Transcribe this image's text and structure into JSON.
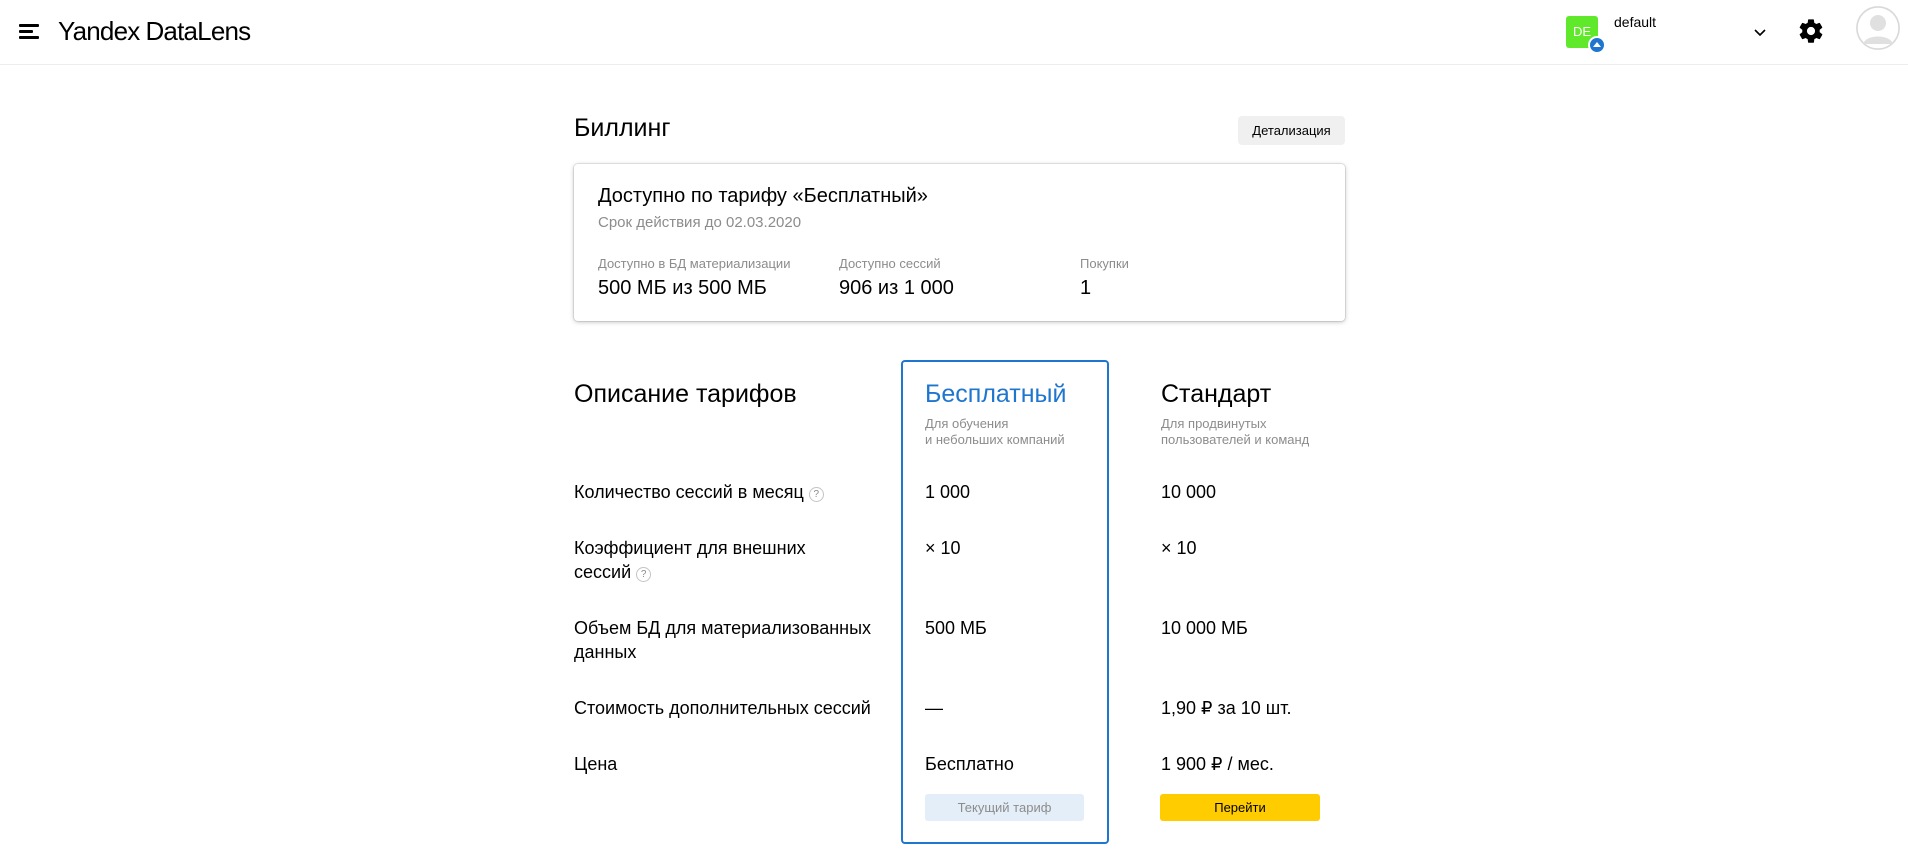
{
  "header": {
    "logo_brand": "Yandex",
    "logo_product": "DataLens",
    "project": {
      "avatar_text": "DE",
      "avatar_color": "#5fe92a",
      "name": "default"
    },
    "icons": [
      "menu-icon",
      "chevron-down-icon",
      "gear-icon",
      "user-icon"
    ]
  },
  "billing": {
    "title": "Биллинг",
    "details_button": "Детализация",
    "summary": {
      "title": "Доступно по тарифу «Бесплатный»",
      "validity": "Срок действия до 02.03.2020",
      "stats": [
        {
          "label": "Доступно в БД материализации",
          "value": "500 МБ из 500 МБ"
        },
        {
          "label": "Доступно сессий",
          "value": "906 из 1 000"
        },
        {
          "label": "Покупки",
          "value": "1"
        }
      ]
    }
  },
  "tariffs": {
    "title": "Описание тарифов",
    "accent_color": "#1f76ce",
    "plans": [
      {
        "name": "Бесплатный",
        "desc_line1": "Для обучения",
        "desc_line2": "и небольших компаний",
        "button": "Текущий тариф"
      },
      {
        "name": "Стандарт",
        "desc_line1": "Для продвинутых",
        "desc_line2": "пользователей и команд",
        "button": "Перейти"
      }
    ],
    "rows": [
      {
        "label": "Количество сессий в месяц",
        "help": "?",
        "free": "1 000",
        "standard": "10 000"
      },
      {
        "label": "Коэффициент для внешних сессий",
        "help": "?",
        "free": "× 10",
        "standard": "× 10"
      },
      {
        "label": "Объем БД для материализованных данных",
        "free": "500 МБ",
        "standard": "10 000 МБ"
      },
      {
        "label": "Стоимость дополнительных сессий",
        "free": "—",
        "standard": "1,90 ₽ за 10 шт."
      },
      {
        "label": "Цена",
        "free": "Бесплатно",
        "standard": "1 900 ₽ / мес."
      }
    ],
    "button_colors": {
      "go": "#ffcc00",
      "current": "#e4eef9"
    }
  }
}
